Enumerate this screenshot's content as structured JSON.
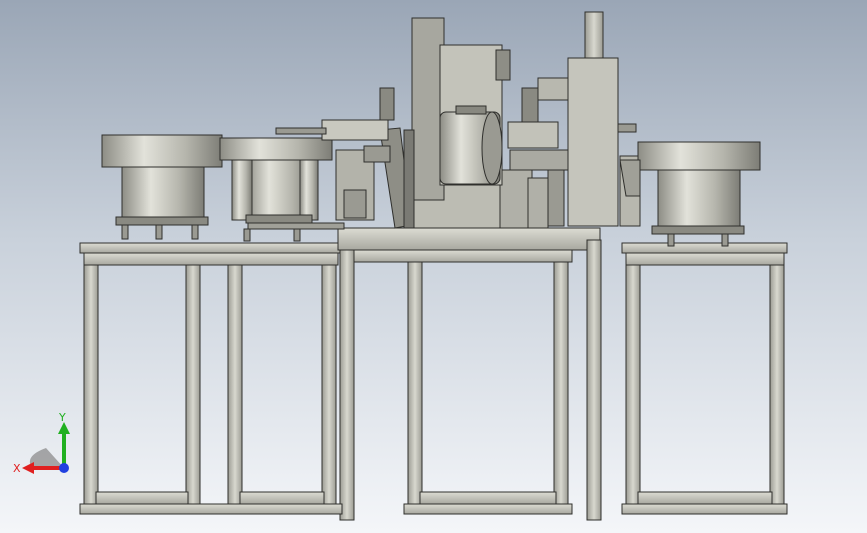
{
  "viewport": {
    "background_top": "#9aa6b6",
    "background_bottom": "#f4f6f9",
    "model_steel": "#b9b9b0",
    "model_dark": "#7a7a74",
    "frame_line": "#2f2f2c"
  },
  "triad": {
    "x_label": "X",
    "y_label": "Y",
    "x_color": "#e02020",
    "y_color": "#20b020",
    "z_color": "#2040e0"
  }
}
